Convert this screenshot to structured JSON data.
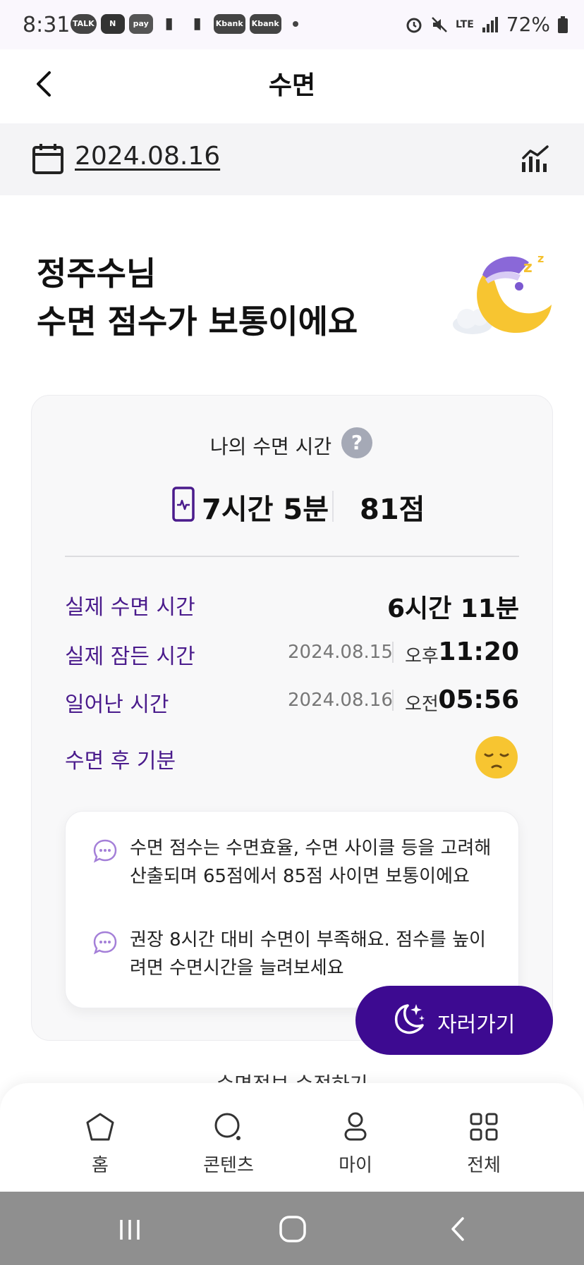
{
  "status_bar": {
    "time": "8:31",
    "notification_icons": [
      "TALK",
      "N",
      "pay",
      "",
      "",
      "Kbank",
      "Kbank"
    ],
    "network": "LTE",
    "battery": "72%"
  },
  "header": {
    "title": "수면"
  },
  "date_bar": {
    "date": "2024.08.16"
  },
  "headline": {
    "line1": "정주수님",
    "line2": "수면 점수가 보통이에요"
  },
  "card": {
    "title": "나의 수면 시간",
    "total_time": "7시간 5분",
    "score": "81점",
    "rows": {
      "actual_sleep": {
        "label": "실제 수면 시간",
        "value": "6시간 11분"
      },
      "fell_asleep": {
        "label": "실제 잠든 시간",
        "date": "2024.08.15",
        "ampm": "오후",
        "time": "11:20"
      },
      "woke_up": {
        "label": "일어난 시간",
        "date": "2024.08.16",
        "ampm": "오전",
        "time": "05:56"
      },
      "mood": {
        "label": "수면 후 기분"
      }
    },
    "info": {
      "item1": "수면 점수는 수면효율, 수면 사이클 등을 고려해 산출되며 65점에서 85점 사이면 보통이에요",
      "item2": "권장 8시간 대비 수면이 부족해요. 점수를 높이려면 수면시간을 늘려보세요"
    }
  },
  "fab": {
    "label": "자러가기"
  },
  "edit_link": "수면정보 수정하기",
  "bottom_nav": {
    "home": "홈",
    "contents": "콘텐츠",
    "my": "마이",
    "all": "전체"
  },
  "colors": {
    "accent": "#3d0a91",
    "label_purple": "#4a1b8c",
    "date_bar_bg": "#f4f4f6"
  }
}
